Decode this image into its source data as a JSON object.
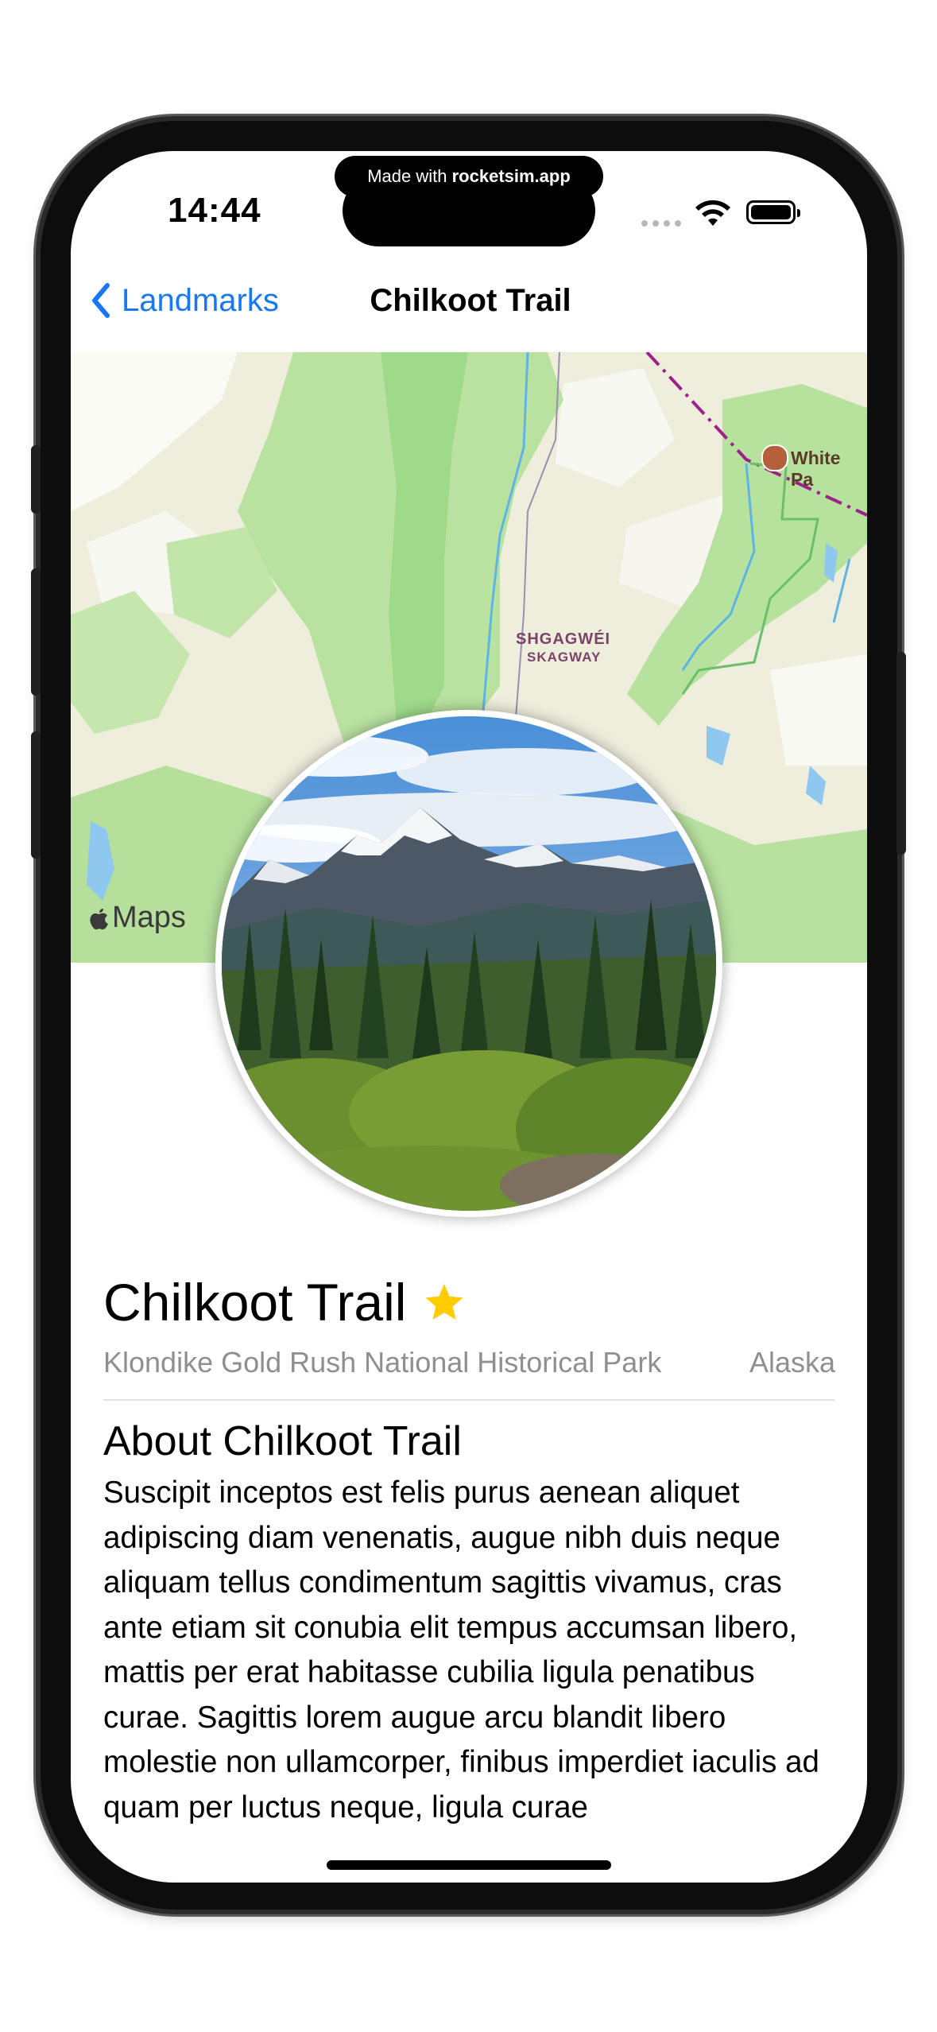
{
  "status_bar": {
    "time": "14:44",
    "made_with_prefix": "Made with ",
    "made_with_brand": "rocketsim.app"
  },
  "nav": {
    "back_label": "Landmarks",
    "title": "Chilkoot Trail"
  },
  "map": {
    "place_label_native": "SHGAGWÉI",
    "place_label": "SKAGWAY",
    "poi_label": "White Pa",
    "attribution": "Maps"
  },
  "landmark": {
    "name": "Chilkoot Trail",
    "favorite": true,
    "park": "Klondike Gold Rush National Historical Park",
    "state": "Alaska",
    "about_heading": "About Chilkoot Trail",
    "description": "Suscipit inceptos est felis purus aenean aliquet adipiscing diam venenatis, augue nibh duis neque aliquam tellus condimentum sagittis vivamus, cras ante etiam sit conubia elit tempus accumsan libero, mattis per erat habitasse cubilia ligula penatibus curae. Sagittis lorem augue arcu blandit libero molestie non ullamcorper, finibus imperdiet iaculis ad quam per luctus neque, ligula curae"
  },
  "colors": {
    "accent": "#1877f2",
    "star": "#ffcc00",
    "secondary_text": "#8e8e93"
  }
}
